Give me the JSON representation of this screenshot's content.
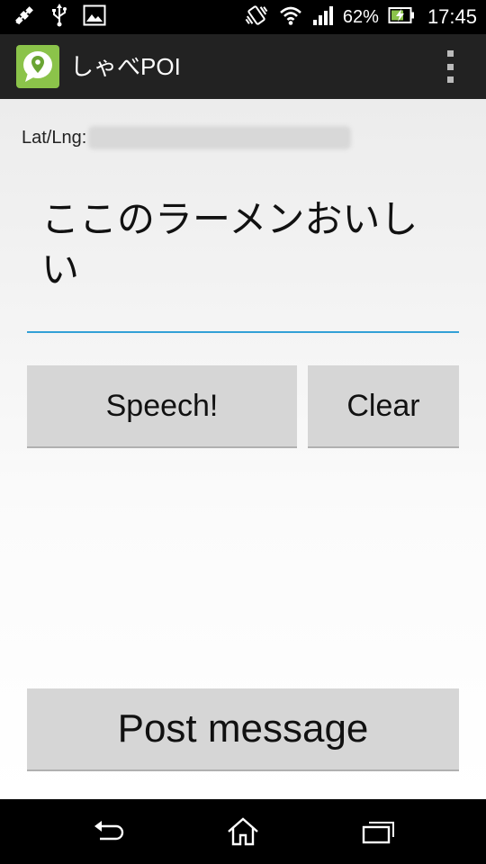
{
  "status_bar": {
    "battery_percent": "62%",
    "time": "17:45"
  },
  "action_bar": {
    "title": "しゃべPOI"
  },
  "main": {
    "latlng_label": "Lat/Lng:",
    "latlng_value": "",
    "message_text": "ここのラーメンおいしい",
    "speech_button_label": "Speech!",
    "clear_button_label": "Clear",
    "post_button_label": "Post message"
  },
  "colors": {
    "accent": "#33a0d6",
    "app_icon": "#8bc34a",
    "action_bar_bg": "#222222"
  }
}
